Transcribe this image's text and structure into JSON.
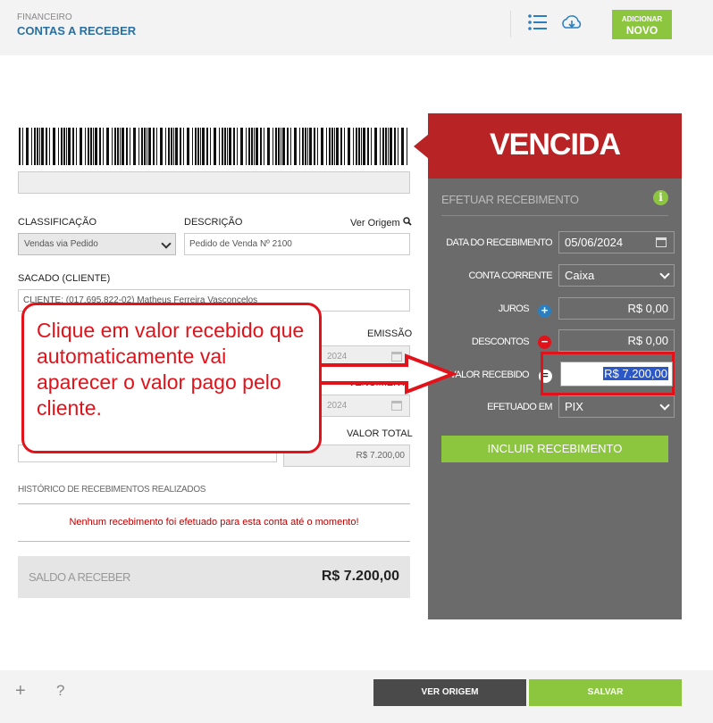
{
  "header": {
    "section": "FINANCEIRO",
    "title": "CONTAS A RECEBER",
    "add_new_line1": "ADICIONAR",
    "add_new_line2": "NOVO"
  },
  "form": {
    "classificacao_label": "CLASSIFICAÇÃO",
    "classificacao_value": "Vendas via Pedido",
    "descricao_label": "DESCRIÇÃO",
    "descricao_value": "Pedido de Venda Nº 2100",
    "ver_origem_link": "Ver Origem",
    "sacado_label": "SACADO (CLIENTE)",
    "sacado_value": "CLIENTE: (017.695.822-02) Matheus Ferreira Vasconcelos",
    "emissao_label": "EMISSÃO",
    "emissao_value": "2024",
    "vencimento_label": "VENCIMENTO",
    "vencimento_value": "2024",
    "valor_total_label": "VALOR TOTAL",
    "valor_total_value": "R$ 7.200,00"
  },
  "history": {
    "title": "HISTÓRICO DE RECEBIMENTOS REALIZADOS",
    "empty_message": "Nenhum recebimento foi efetuado para esta conta até o momento!",
    "saldo_label": "SALDO A RECEBER",
    "saldo_value": "R$ 7.200,00"
  },
  "panel": {
    "status": "VENCIDA",
    "title": "EFETUAR RECEBIMENTO",
    "data_label": "DATA DO RECEBIMENTO",
    "data_value": "05/06/2024",
    "conta_label": "CONTA CORRENTE",
    "conta_value": "Caixa",
    "juros_label": "JUROS",
    "juros_value": "R$ 0,00",
    "descontos_label": "DESCONTOS",
    "descontos_value": "R$ 0,00",
    "valor_label": "VALOR RECEBIDO",
    "valor_value": "R$ 7.200,00",
    "efetuado_label": "EFETUADO EM",
    "efetuado_value": "PIX",
    "incluir_button": "INCLUIR RECEBIMENTO"
  },
  "callout": {
    "text": "Clique em valor recebido que automaticamente vai aparecer o valor pago pelo cliente."
  },
  "footer": {
    "plus": "+",
    "help": "?",
    "ver_origem_button": "VER ORIGEM",
    "salvar_button": "SALVAR"
  },
  "colors": {
    "accent_green": "#8cc63f",
    "status_red": "#b82325",
    "panel_gray": "#6b6b6b",
    "title_blue": "#2b6f9e",
    "annotation_red": "#e2121a"
  }
}
